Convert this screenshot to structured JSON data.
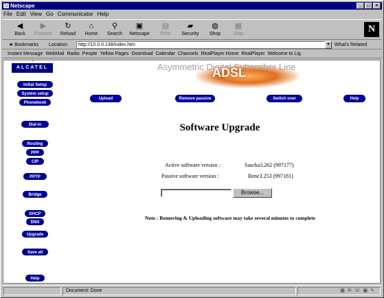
{
  "window": {
    "title": "Netscape",
    "controls": [
      "_",
      "□",
      "×"
    ]
  },
  "menu": [
    "File",
    "Edit",
    "View",
    "Go",
    "Communicator",
    "Help"
  ],
  "toolbar": {
    "buttons": [
      {
        "label": "Back",
        "icon": "back-arrow-icon",
        "glyph": "◀",
        "disabled": false
      },
      {
        "label": "Forward",
        "icon": "forward-arrow-icon",
        "glyph": "▶",
        "disabled": true
      },
      {
        "label": "Reload",
        "icon": "reload-icon",
        "glyph": "↻",
        "disabled": false
      },
      {
        "label": "Home",
        "icon": "home-icon",
        "glyph": "⌂",
        "disabled": false
      },
      {
        "label": "Search",
        "icon": "search-icon",
        "glyph": "⚲",
        "disabled": false
      },
      {
        "label": "Netscape",
        "icon": "netscape-icon",
        "glyph": "▣",
        "disabled": false
      },
      {
        "label": "Print",
        "icon": "print-icon",
        "glyph": "▤",
        "disabled": true
      },
      {
        "label": "Security",
        "icon": "security-lock-icon",
        "glyph": "▰",
        "disabled": false
      },
      {
        "label": "Shop",
        "icon": "shop-icon",
        "glyph": "◍",
        "disabled": false
      },
      {
        "label": "Stop",
        "icon": "stop-icon",
        "glyph": "▦",
        "disabled": true
      }
    ],
    "logo": "N"
  },
  "location": {
    "bookmarks_label": "Bookmarks",
    "location_label": "Location:",
    "url": "http://10.0.0.138/index.htm",
    "related_label": "What's Related"
  },
  "links": [
    "Instant Message",
    "WebMail",
    "Radio",
    "People",
    "Yellow Pages",
    "Download",
    "Calendar",
    "Channels",
    "RealPlayer Home",
    "RealPlayer",
    "Welcome to Lig"
  ],
  "page": {
    "brand": "ALCATEL",
    "banner_text": "Asymmetric Digital Subscriber Line",
    "banner_logo": "ADSL",
    "sidebar": [
      {
        "label": "Initial Setup"
      },
      {
        "label": "System setup"
      },
      {
        "label": "Phonebook"
      },
      {
        "label": "Dial-in"
      },
      {
        "label": "Routing"
      },
      {
        "label": "PPP"
      },
      {
        "label": "CIP"
      },
      {
        "label": "PPTP"
      },
      {
        "label": "Bridge"
      },
      {
        "label": "DHCP"
      },
      {
        "label": "DNS"
      },
      {
        "label": "Upgrade"
      },
      {
        "label": "Save all"
      },
      {
        "label": "Help"
      }
    ],
    "top_buttons": {
      "upload": "Upload",
      "remove_passive": "Remove passive",
      "switch_over": "Switch over",
      "help": "Help"
    },
    "title": "Software Upgrade",
    "active_label": "Active software version :",
    "active_value": "Sascha3.262  (997177)",
    "passive_label": "Passive software version :",
    "passive_value": "Bene3.253  (997181)",
    "browse_label": "Browse...",
    "file_value": "",
    "note": "Note : Removing & Uploading software may take several minutes to complete"
  },
  "status": {
    "text": "Document: Done"
  }
}
